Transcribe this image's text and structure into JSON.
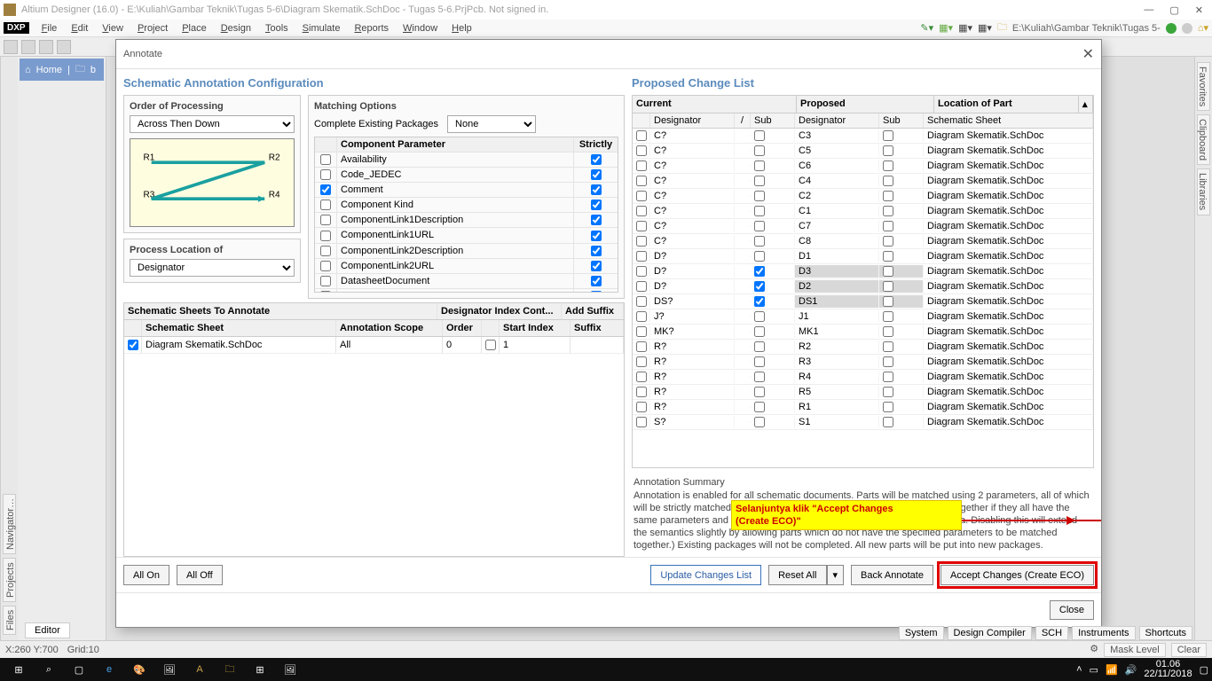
{
  "titlebar": {
    "title": "Altium Designer (16.0) - E:\\Kuliah\\Gambar Teknik\\Tugas 5-6\\Diagram Skematik.SchDoc - Tugas 5-6.PrjPcb. Not signed in."
  },
  "menu": {
    "dxp": "DXP",
    "items": [
      "File",
      "Edit",
      "View",
      "Project",
      "Place",
      "Design",
      "Tools",
      "Simulate",
      "Reports",
      "Window",
      "Help"
    ],
    "path_field": "E:\\Kuliah\\Gambar Teknik\\Tugas 5-"
  },
  "left_tabs": [
    "Files",
    "Projects",
    "Navigator…"
  ],
  "right_tabs": [
    "Favorites",
    "Clipboard",
    "Libraries"
  ],
  "home_bar": {
    "home": "Home",
    "b": "b"
  },
  "dialog": {
    "title": "Annotate",
    "left_heading": "Schematic Annotation Configuration",
    "right_heading": "Proposed Change List",
    "order_group": {
      "title": "Order of Processing",
      "value": "Across Then Down",
      "labels": [
        "R1",
        "R2",
        "R3",
        "R4"
      ]
    },
    "process_loc": {
      "title": "Process Location of",
      "value": "Designator"
    },
    "matching": {
      "title": "Matching Options",
      "complete_label": "Complete Existing Packages",
      "complete_value": "None",
      "cols": {
        "param": "Component Parameter",
        "strict": "Strictly"
      },
      "rows": [
        {
          "chk": false,
          "name": "Availability",
          "strict": true
        },
        {
          "chk": false,
          "name": "Code_JEDEC",
          "strict": true
        },
        {
          "chk": true,
          "name": "Comment",
          "strict": true
        },
        {
          "chk": false,
          "name": "Component Kind",
          "strict": true
        },
        {
          "chk": false,
          "name": "ComponentLink1Description",
          "strict": true
        },
        {
          "chk": false,
          "name": "ComponentLink1URL",
          "strict": true
        },
        {
          "chk": false,
          "name": "ComponentLink2Description",
          "strict": true
        },
        {
          "chk": false,
          "name": "ComponentLink2URL",
          "strict": true
        },
        {
          "chk": false,
          "name": "DatasheetDocument",
          "strict": true
        },
        {
          "chk": false,
          "name": "DatasheetVersion",
          "strict": true
        }
      ]
    },
    "sheets": {
      "title": "Schematic Sheets To Annotate",
      "cols": {
        "sheet": "Schematic Sheet",
        "scope": "Annotation Scope",
        "order": "Order",
        "dix": "Designator Index Cont...",
        "start": "Start Index",
        "suffix": "Suffix",
        "addsuffix": "Add Suffix"
      },
      "rows": [
        {
          "chk": true,
          "sheet": "Diagram Skematik.SchDoc",
          "scope": "All",
          "order": "0",
          "start": "1",
          "suffix": ""
        }
      ]
    },
    "proposed": {
      "head1": {
        "cur": "Current",
        "prop": "Proposed",
        "loc": "Location of Part"
      },
      "head2": {
        "des": "Designator",
        "sub": "Sub",
        "sheet": "Schematic Sheet"
      },
      "rows": [
        {
          "cur": "C?",
          "sub": false,
          "prop": "C3",
          "psub": false,
          "sheet": "Diagram Skematik.SchDoc"
        },
        {
          "cur": "C?",
          "sub": false,
          "prop": "C5",
          "psub": false,
          "sheet": "Diagram Skematik.SchDoc"
        },
        {
          "cur": "C?",
          "sub": false,
          "prop": "C6",
          "psub": false,
          "sheet": "Diagram Skematik.SchDoc"
        },
        {
          "cur": "C?",
          "sub": false,
          "prop": "C4",
          "psub": false,
          "sheet": "Diagram Skematik.SchDoc"
        },
        {
          "cur": "C?",
          "sub": false,
          "prop": "C2",
          "psub": false,
          "sheet": "Diagram Skematik.SchDoc"
        },
        {
          "cur": "C?",
          "sub": false,
          "prop": "C1",
          "psub": false,
          "sheet": "Diagram Skematik.SchDoc"
        },
        {
          "cur": "C?",
          "sub": false,
          "prop": "C7",
          "psub": false,
          "sheet": "Diagram Skematik.SchDoc"
        },
        {
          "cur": "C?",
          "sub": false,
          "prop": "C8",
          "psub": false,
          "sheet": "Diagram Skematik.SchDoc"
        },
        {
          "cur": "D?",
          "sub": false,
          "prop": "D1",
          "psub": false,
          "sheet": "Diagram Skematik.SchDoc"
        },
        {
          "cur": "D?",
          "sub": true,
          "prop": "D3",
          "psub": false,
          "sheet": "Diagram Skematik.SchDoc",
          "locked": true
        },
        {
          "cur": "D?",
          "sub": true,
          "prop": "D2",
          "psub": false,
          "sheet": "Diagram Skematik.SchDoc",
          "locked": true
        },
        {
          "cur": "DS?",
          "sub": true,
          "prop": "DS1",
          "psub": false,
          "sheet": "Diagram Skematik.SchDoc",
          "locked": true
        },
        {
          "cur": "J?",
          "sub": false,
          "prop": "J1",
          "psub": false,
          "sheet": "Diagram Skematik.SchDoc"
        },
        {
          "cur": "MK?",
          "sub": false,
          "prop": "MK1",
          "psub": false,
          "sheet": "Diagram Skematik.SchDoc"
        },
        {
          "cur": "R?",
          "sub": false,
          "prop": "R2",
          "psub": false,
          "sheet": "Diagram Skematik.SchDoc"
        },
        {
          "cur": "R?",
          "sub": false,
          "prop": "R3",
          "psub": false,
          "sheet": "Diagram Skematik.SchDoc"
        },
        {
          "cur": "R?",
          "sub": false,
          "prop": "R4",
          "psub": false,
          "sheet": "Diagram Skematik.SchDoc"
        },
        {
          "cur": "R?",
          "sub": false,
          "prop": "R5",
          "psub": false,
          "sheet": "Diagram Skematik.SchDoc"
        },
        {
          "cur": "R?",
          "sub": false,
          "prop": "R1",
          "psub": false,
          "sheet": "Diagram Skematik.SchDoc"
        },
        {
          "cur": "S?",
          "sub": false,
          "prop": "S1",
          "psub": false,
          "sheet": "Diagram Skematik.SchDoc"
        }
      ]
    },
    "summary": {
      "title": "Annotation Summary",
      "text": "Annotation is enabled for all schematic documents. Parts will be matched using 2 parameters, all of which will be strictly matched. (Under strict matching, parts will only be matched together if they all have the same parameters and parameter values, with respect to the matching criteria. Disabling this will extend the semantics slightly by allowing parts which do not have the specified parameters to be matched together.) Existing packages will not be completed. All new parts will be put into new packages.",
      "callout1": "Selanjuntya klik \"Accept Changes",
      "callout2": "(Create ECO)\""
    },
    "buttons": {
      "all_on": "All On",
      "all_off": "All Off",
      "update": "Update Changes List",
      "reset": "Reset All",
      "back": "Back Annotate",
      "accept": "Accept Changes (Create ECO)",
      "close": "Close"
    }
  },
  "status": {
    "coords": "X:260 Y:700",
    "grid": "Grid:10",
    "chips": [
      "System",
      "Design Compiler",
      "SCH",
      "Instruments",
      "Shortcuts"
    ],
    "mask": "Mask Level",
    "clear": "Clear",
    "editor": "Editor"
  },
  "taskbar": {
    "time": "01.06",
    "date": "22/11/2018"
  }
}
